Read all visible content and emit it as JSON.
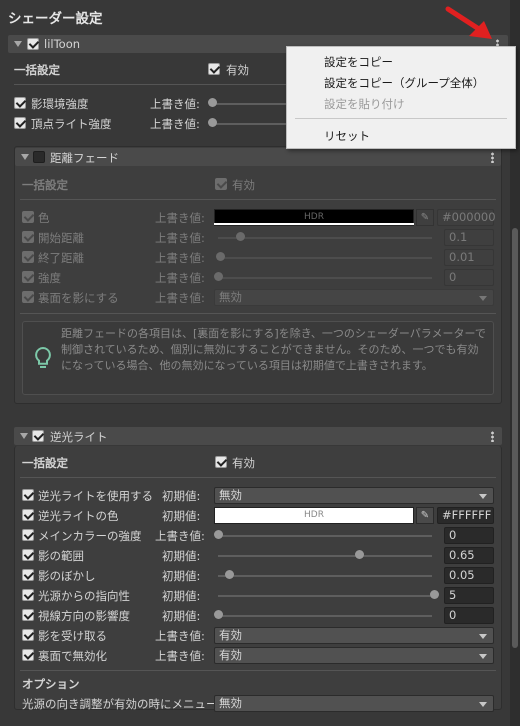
{
  "window_title": "シェーダー設定",
  "main_section": {
    "title": "lilToon"
  },
  "global_block": {
    "label": "一括設定",
    "toggle_label": "有効",
    "rows": [
      {
        "label": "影環境強度",
        "value_label": "上書き値:"
      },
      {
        "label": "頂点ライト強度",
        "value_label": "上書き値:"
      }
    ]
  },
  "distance_fade": {
    "title": "距離フェード",
    "global_label": "一括設定",
    "toggle_label": "有効",
    "rows": [
      {
        "label": "色",
        "value_label": "上書き値:",
        "hdr": "HDR",
        "hex": "#000000",
        "color": "#000000"
      },
      {
        "label": "開始距離",
        "value_label": "上書き値:",
        "value": "0.1",
        "slider": 0.1
      },
      {
        "label": "終了距離",
        "value_label": "上書き値:",
        "value": "0.01",
        "slider": 0.01
      },
      {
        "label": "強度",
        "value_label": "上書き値:",
        "value": "0",
        "slider": 0
      },
      {
        "label": "裏面を影にする",
        "value_label": "上書き値:",
        "dropdown": "無効"
      }
    ],
    "info_text": "距離フェードの各項目は、[裏面を影にする]を除き、一つのシェーダーパラメーターで制御されているため、個別に無効にすることができません。そのため、一つでも有効になっている場合、他の無効になっている項目は初期値で上書きされます。"
  },
  "backlight": {
    "title": "逆光ライト",
    "global_label": "一括設定",
    "toggle_label": "有効",
    "rows": [
      {
        "label": "逆光ライトを使用する",
        "value_label": "初期値:",
        "dropdown": "無効"
      },
      {
        "label": "逆光ライトの色",
        "value_label": "初期値:",
        "hdr": "HDR",
        "hex": "#FFFFFF",
        "color": "#FFFFFF"
      },
      {
        "label": "メインカラーの強度",
        "value_label": "上書き値:",
        "value": "0",
        "slider": 0
      },
      {
        "label": "影の範囲",
        "value_label": "初期値:",
        "value": "0.65",
        "slider": 0.65
      },
      {
        "label": "影のぼかし",
        "value_label": "初期値:",
        "value": "0.05",
        "slider": 0.05
      },
      {
        "label": "光源からの指向性",
        "value_label": "初期値:",
        "value": "5",
        "slider": 1.0
      },
      {
        "label": "視線方向の影響度",
        "value_label": "初期値:",
        "value": "0",
        "slider": 0
      },
      {
        "label": "影を受け取る",
        "value_label": "上書き値:",
        "dropdown": "有効"
      },
      {
        "label": "裏面で無効化",
        "value_label": "上書き値:",
        "dropdown": "有効"
      }
    ],
    "options_label": "オプション",
    "option_row": {
      "label": "光源の向き調整が有効の時にメニューを追",
      "dropdown": "無効"
    }
  },
  "context_menu": {
    "items": [
      {
        "label": "設定をコピー",
        "enabled": true
      },
      {
        "label": "設定をコピー（グループ全体）",
        "enabled": true
      },
      {
        "label": "設定を貼り付け",
        "enabled": false
      },
      {
        "label": "リセット",
        "enabled": true
      }
    ]
  },
  "colors": {
    "background": "#383838",
    "arrow": "#e02020",
    "accent": "#e8e8e8"
  }
}
